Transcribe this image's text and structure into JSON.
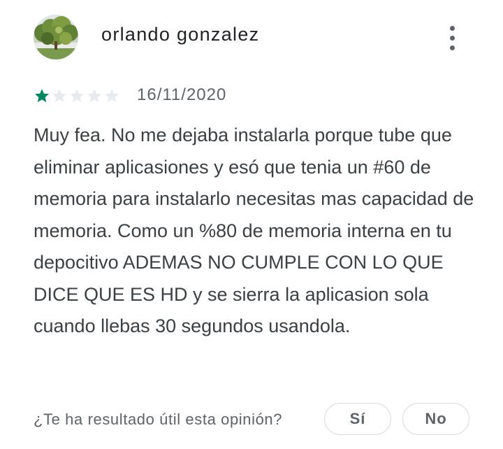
{
  "review": {
    "author": "orlando gonzalez",
    "rating": 1,
    "max_rating": 5,
    "date": "16/11/2020",
    "text": "Muy fea. No me dejaba instalarla porque tube que eliminar aplicasiones y esó que tenia un #60 de memoria para instalarlo necesitas mas capacidad de memoria. Como un %80 de memoria interna en tu depocitivo ADEMAS NO CUMPLE CON LO QUE DICE QUE ES HD y se sierra la aplicasion sola cuando llebas 30 segundos usandola.",
    "avatar_icon": "tree-photo-avatar",
    "more_icon": "more-vert-icon"
  },
  "helpful": {
    "question": "¿Te ha resultado útil esta opinión?",
    "yes_label": "Sí",
    "no_label": "No"
  },
  "colors": {
    "star_filled": "#01875f",
    "star_empty": "#e8eaed",
    "text_primary": "#202124",
    "text_secondary": "#5f6368",
    "border": "#dadce0"
  }
}
